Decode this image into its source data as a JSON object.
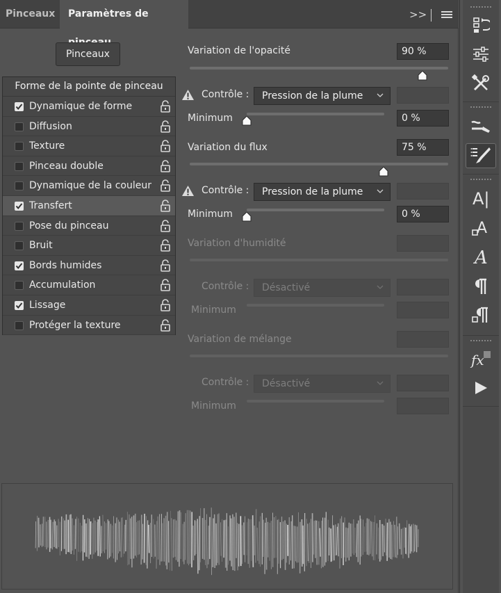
{
  "tabs": [
    {
      "label": "Pinceaux"
    },
    {
      "label": "Paramètres de pinceau"
    }
  ],
  "tab_controls": {
    "expand": ">>"
  },
  "brushes_button": "Pinceaux",
  "list": {
    "header": "Forme de la pointe de pinceau",
    "items": [
      {
        "label": "Dynamique de forme",
        "checked": true
      },
      {
        "label": "Diffusion",
        "checked": false
      },
      {
        "label": "Texture",
        "checked": false
      },
      {
        "label": "Pinceau double",
        "checked": false
      },
      {
        "label": "Dynamique de la couleur",
        "checked": false
      },
      {
        "label": "Transfert",
        "checked": true,
        "selected": true
      },
      {
        "label": "Pose du pinceau",
        "checked": false
      },
      {
        "label": "Bruit",
        "checked": false
      },
      {
        "label": "Bords humides",
        "checked": true
      },
      {
        "label": "Accumulation",
        "checked": false
      },
      {
        "label": "Lissage",
        "checked": true
      },
      {
        "label": "Protéger la texture",
        "checked": false
      }
    ]
  },
  "settings": {
    "opacity": {
      "label": "Variation de l'opacité",
      "value": "90 %",
      "level": 0.9,
      "control_label": "Contrôle :",
      "control_value": "Pression de la plume",
      "min_label": "Minimum",
      "min_value": "0 %",
      "min_level": 0
    },
    "flow": {
      "label": "Variation du flux",
      "value": "75 %",
      "level": 0.75,
      "control_label": "Contrôle :",
      "control_value": "Pression de la plume",
      "min_label": "Minimum",
      "min_value": "0 %",
      "min_level": 0
    },
    "wetness": {
      "label": "Variation d'humidité",
      "control_label": "Contrôle :",
      "control_value": "Désactivé",
      "min_label": "Minimum"
    },
    "mix": {
      "label": "Variation de mélange",
      "control_label": "Contrôle :",
      "control_value": "Désactivé",
      "min_label": "Minimum"
    }
  },
  "toolstrip": {
    "icons": [
      "history-icon",
      "adjustments-icon",
      "tools-icon",
      "brush-presets-icon",
      "brush-settings-icon",
      "character-icon",
      "character-styles-icon",
      "glyphs-icon",
      "paragraph-icon",
      "paragraph-styles-icon",
      "styles-fx-icon",
      "actions-play-icon"
    ],
    "character_glyph": "A|",
    "fx_glyph": "fx"
  },
  "colors": {
    "panel": "#535353",
    "tabbar": "#424242",
    "field": "#3b3b3b"
  }
}
